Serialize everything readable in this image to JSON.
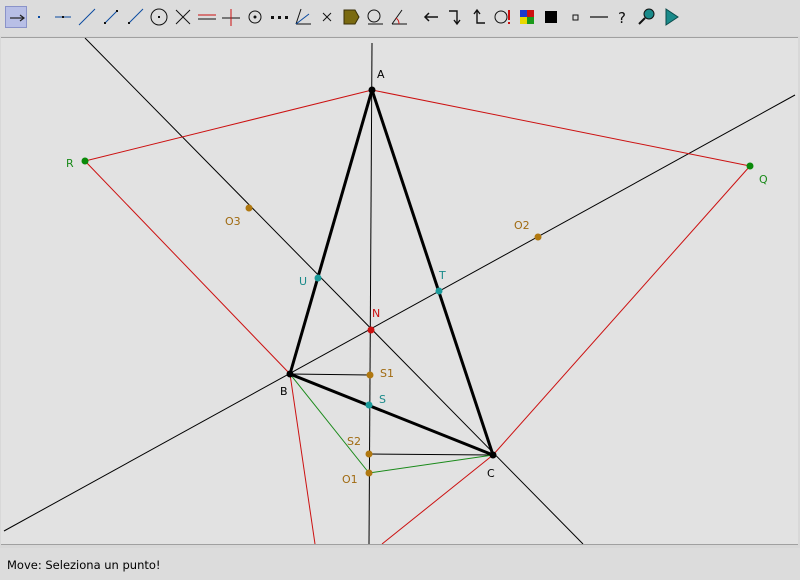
{
  "toolbar": {
    "tools": [
      {
        "name": "move-tool",
        "selected": true
      },
      {
        "name": "point-tool"
      },
      {
        "name": "point-on-object-tool"
      },
      {
        "name": "line-tool"
      },
      {
        "name": "segment-tool"
      },
      {
        "name": "ray-tool"
      },
      {
        "name": "circle-tool"
      },
      {
        "name": "intersection-tool"
      },
      {
        "name": "parallel-line-tool"
      },
      {
        "name": "perpendicular-line-tool"
      },
      {
        "name": "circle-center-tool"
      },
      {
        "name": "midpoint-tool"
      },
      {
        "name": "angle-bisector-tool"
      },
      {
        "name": "delete-tool"
      },
      {
        "name": "label-tool"
      },
      {
        "name": "measure-tool"
      },
      {
        "name": "angle-tool"
      },
      {
        "name": "undo-tool"
      },
      {
        "name": "redo-tool"
      },
      {
        "name": "back-tool"
      },
      {
        "name": "show-hide-tool"
      },
      {
        "name": "color-tool"
      },
      {
        "name": "thick-tool"
      },
      {
        "name": "thin-tool"
      },
      {
        "name": "line-style-tool"
      },
      {
        "name": "help-tool"
      },
      {
        "name": "zoom-tool"
      },
      {
        "name": "animation-tool"
      }
    ]
  },
  "colors": {
    "black": "#000000",
    "red": "#cc1111",
    "green_line": "#1a8a1a",
    "green_point": "#0a8a0a",
    "teal": "#1a9a9a",
    "brown": "#b07810",
    "label_green": "#1a8a1a",
    "label_brown": "#a06a10",
    "label_teal": "#1a8a8a",
    "label_red": "#cc1111"
  },
  "points": {
    "A": {
      "label": "A"
    },
    "B": {
      "label": "B"
    },
    "C": {
      "label": "C"
    },
    "R": {
      "label": "R"
    },
    "Q": {
      "label": "Q"
    },
    "O1": {
      "label": "O1"
    },
    "O2": {
      "label": "O2"
    },
    "O3": {
      "label": "O3"
    },
    "U": {
      "label": "U"
    },
    "T": {
      "label": "T"
    },
    "N": {
      "label": "N"
    },
    "S": {
      "label": "S"
    },
    "S1": {
      "label": "S1"
    },
    "S2": {
      "label": "S2"
    }
  },
  "status": {
    "text": "Move: Seleziona un punto!"
  }
}
